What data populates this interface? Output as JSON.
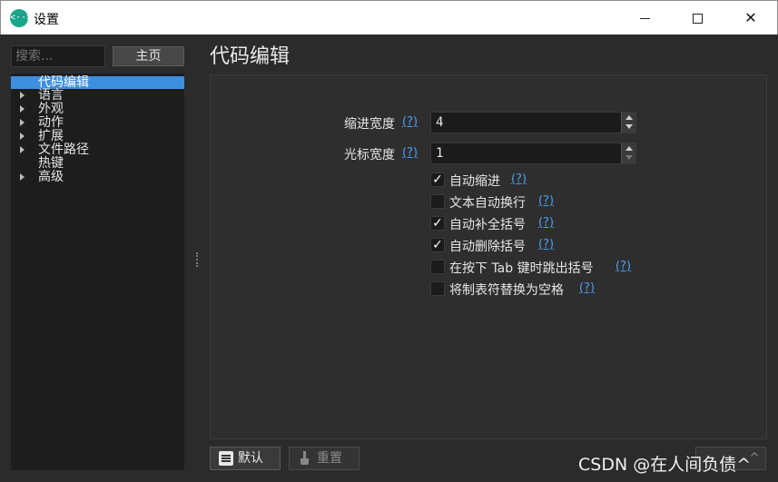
{
  "window": {
    "title": "设置",
    "icon_text": "<··>",
    "close_glyph": "✕"
  },
  "sidebar": {
    "search_placeholder": "搜索...",
    "home_label": "主页",
    "items": [
      {
        "label": "代码编辑",
        "expandable": false,
        "selected": true
      },
      {
        "label": "语言",
        "expandable": true,
        "selected": false
      },
      {
        "label": "外观",
        "expandable": true,
        "selected": false
      },
      {
        "label": "动作",
        "expandable": true,
        "selected": false
      },
      {
        "label": "扩展",
        "expandable": true,
        "selected": false
      },
      {
        "label": "文件路径",
        "expandable": true,
        "selected": false
      },
      {
        "label": "热键",
        "expandable": false,
        "selected": false
      },
      {
        "label": "高级",
        "expandable": true,
        "selected": false
      }
    ]
  },
  "main": {
    "title": "代码编辑",
    "help_text": "(?)",
    "indent_width": {
      "label": "缩进宽度",
      "value": "4"
    },
    "cursor_width": {
      "label": "光标宽度",
      "value": "1"
    },
    "checkboxes": [
      {
        "label": "自动缩进",
        "checked": true
      },
      {
        "label": "文本自动换行",
        "checked": false
      },
      {
        "label": "自动补全括号",
        "checked": true
      },
      {
        "label": "自动删除括号",
        "checked": true
      },
      {
        "label": "在按下 Tab 键时跳出括号",
        "checked": false
      },
      {
        "label": "将制表符替换为空格",
        "checked": false
      }
    ],
    "check_glyph": "✓"
  },
  "footer": {
    "default_label": "默认",
    "reset_label": "重置",
    "apply_label": "^",
    "watermark": "CSDN @在人间负债^"
  },
  "colors": {
    "accent": "#3d8fe0",
    "link": "#4a9ff5",
    "background": "#2b2b2b",
    "app_icon": "#1aa58c"
  }
}
